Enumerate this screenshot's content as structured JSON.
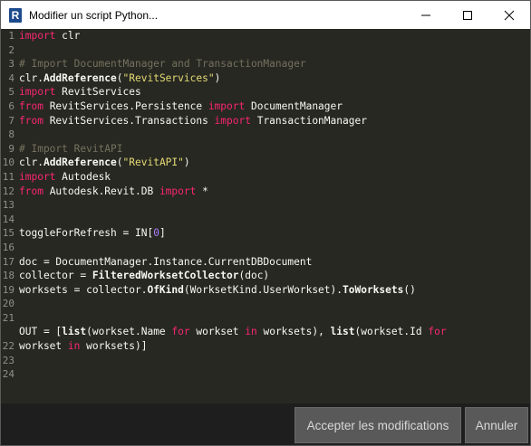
{
  "window": {
    "title": "Modifier un script Python...",
    "app_icon_letter": "R",
    "controls": [
      "minimize-icon",
      "maximize-icon",
      "close-icon"
    ]
  },
  "editor": {
    "line_numbers": [
      "1",
      "2",
      "3",
      "4",
      "5",
      "6",
      "7",
      "8",
      "9",
      "10",
      "11",
      "12",
      "13",
      "14",
      "15",
      "16",
      "17",
      "18",
      "19",
      "20",
      "21",
      "22",
      "23",
      "24"
    ],
    "colors": {
      "background": "#272822",
      "keyword": "#f92672",
      "comment": "#75715e",
      "string": "#e6db74",
      "number": "#ae81ff",
      "text": "#f8f8f2"
    },
    "lines": [
      [
        {
          "t": "import",
          "c": "kw"
        },
        {
          "t": " clr"
        }
      ],
      [],
      [
        {
          "t": "# Import DocumentManager and TransactionManager",
          "c": "cm"
        }
      ],
      [
        {
          "t": "clr."
        },
        {
          "t": "AddReference",
          "c": "fn"
        },
        {
          "t": "("
        },
        {
          "t": "\"RevitServices\"",
          "c": "st"
        },
        {
          "t": ")"
        }
      ],
      [
        {
          "t": "import",
          "c": "kw"
        },
        {
          "t": " RevitServices"
        }
      ],
      [
        {
          "t": "from",
          "c": "kw"
        },
        {
          "t": " RevitServices.Persistence "
        },
        {
          "t": "import",
          "c": "kw"
        },
        {
          "t": " DocumentManager"
        }
      ],
      [
        {
          "t": "from",
          "c": "kw"
        },
        {
          "t": " RevitServices.Transactions "
        },
        {
          "t": "import",
          "c": "kw"
        },
        {
          "t": " TransactionManager"
        }
      ],
      [],
      [
        {
          "t": "# Import RevitAPI",
          "c": "cm"
        }
      ],
      [
        {
          "t": "clr."
        },
        {
          "t": "AddReference",
          "c": "fn"
        },
        {
          "t": "("
        },
        {
          "t": "\"RevitAPI\"",
          "c": "st"
        },
        {
          "t": ")"
        }
      ],
      [
        {
          "t": "import",
          "c": "kw"
        },
        {
          "t": " Autodesk"
        }
      ],
      [
        {
          "t": "from",
          "c": "kw"
        },
        {
          "t": " Autodesk.Revit.DB "
        },
        {
          "t": "import",
          "c": "kw"
        },
        {
          "t": " *"
        }
      ],
      [],
      [],
      [
        {
          "t": "toggleForRefresh = IN["
        },
        {
          "t": "0",
          "c": "nb"
        },
        {
          "t": "]"
        }
      ],
      [],
      [
        {
          "t": "doc = DocumentManager.Instance.CurrentDBDocument"
        }
      ],
      [
        {
          "t": "collector = "
        },
        {
          "t": "FilteredWorksetCollector",
          "c": "fn"
        },
        {
          "t": "(doc)"
        }
      ],
      [
        {
          "t": "worksets = collector."
        },
        {
          "t": "OfKind",
          "c": "fn"
        },
        {
          "t": "(WorksetKind.UserWorkset)."
        },
        {
          "t": "ToWorksets",
          "c": "fn"
        },
        {
          "t": "()"
        }
      ],
      [],
      [],
      [
        {
          "t": "OUT = ["
        },
        {
          "t": "list",
          "c": "fn"
        },
        {
          "t": "(workset.Name "
        },
        {
          "t": "for",
          "c": "kw"
        },
        {
          "t": " workset "
        },
        {
          "t": "in",
          "c": "kw"
        },
        {
          "t": " worksets), "
        },
        {
          "t": "list",
          "c": "fn"
        },
        {
          "t": "(workset.Id "
        },
        {
          "t": "for",
          "c": "kw"
        }
      ],
      [
        {
          "t": "workset "
        },
        {
          "t": "in",
          "c": "kw"
        },
        {
          "t": " worksets)]"
        }
      ],
      [],
      []
    ],
    "visual_line_numbers": [
      "1",
      "2",
      "3",
      "4",
      "5",
      "6",
      "7",
      "8",
      "9",
      "10",
      "11",
      "12",
      "13",
      "14",
      "15",
      "16",
      "17",
      "18",
      "19",
      "20",
      "21",
      "",
      "22",
      "23",
      "24"
    ]
  },
  "footer": {
    "accept_label": "Accepter les modifications",
    "cancel_label": "Annuler"
  }
}
